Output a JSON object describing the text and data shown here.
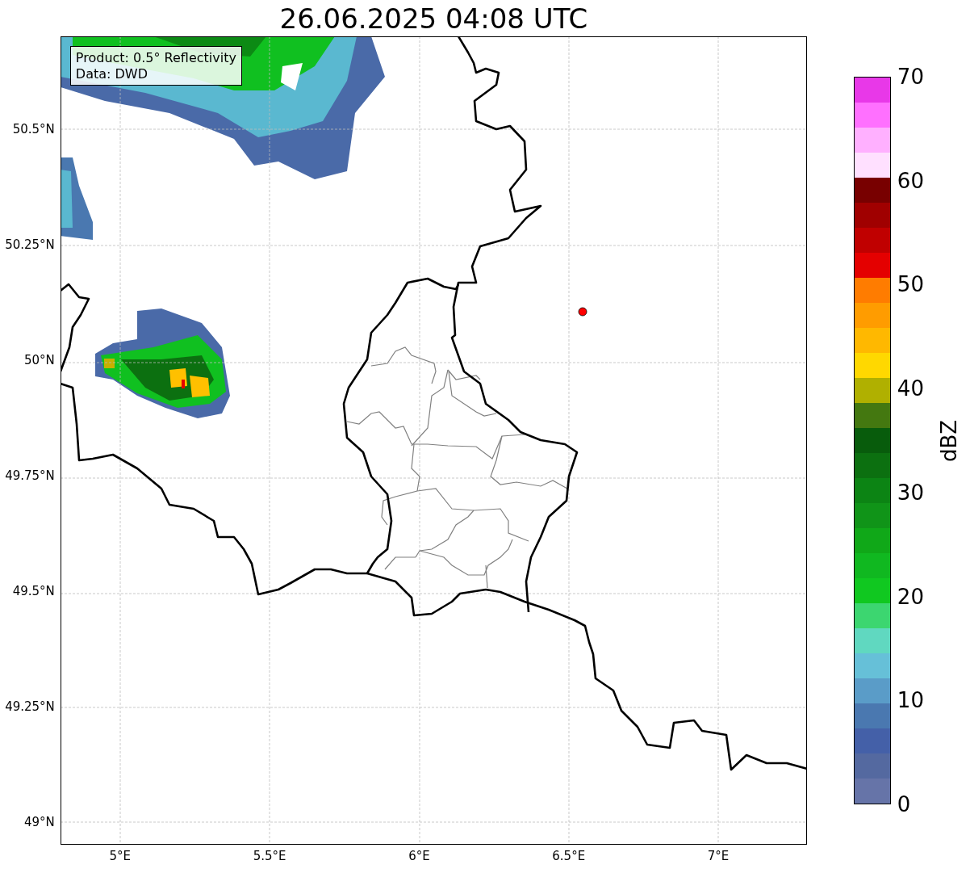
{
  "title": "26.06.2025 04:08 UTC",
  "info_box": {
    "lines": [
      "Product: 0.5° Reflectivity",
      "Data: DWD"
    ]
  },
  "map": {
    "y_ticks": [
      "50.5°N",
      "50.25°N",
      "50°N",
      "49.75°N",
      "49.5°N",
      "49.25°N",
      "49°N"
    ],
    "x_ticks": [
      "5°E",
      "5.5°E",
      "6°E",
      "6.5°E",
      "7°E"
    ]
  },
  "colorbar": {
    "label": "dBZ",
    "ticks": [
      "70",
      "60",
      "50",
      "40",
      "30",
      "20",
      "10",
      "0"
    ],
    "bands": [
      {
        "color": "#e838e8"
      },
      {
        "color": "#ff70ff"
      },
      {
        "color": "#ffb0ff"
      },
      {
        "color": "#ffe0ff"
      },
      {
        "color": "#780000"
      },
      {
        "color": "#a00000"
      },
      {
        "color": "#c00000"
      },
      {
        "color": "#e40000"
      },
      {
        "color": "#ff7c00"
      },
      {
        "color": "#ff9c00"
      },
      {
        "color": "#ffb800"
      },
      {
        "color": "#ffd800"
      },
      {
        "color": "#b0b000"
      },
      {
        "color": "#447810"
      },
      {
        "color": "#085c0c"
      },
      {
        "color": "#0c7010"
      },
      {
        "color": "#0c8414"
      },
      {
        "color": "#109418"
      },
      {
        "color": "#10a818"
      },
      {
        "color": "#10b820"
      },
      {
        "color": "#10c820"
      },
      {
        "color": "#3cd670"
      },
      {
        "color": "#60d8c0"
      },
      {
        "color": "#66c0d8"
      },
      {
        "color": "#5a9cc8"
      },
      {
        "color": "#4a78b0"
      },
      {
        "color": "#4460a8"
      },
      {
        "color": "#5469a0"
      },
      {
        "color": "#6674a8"
      }
    ]
  }
}
